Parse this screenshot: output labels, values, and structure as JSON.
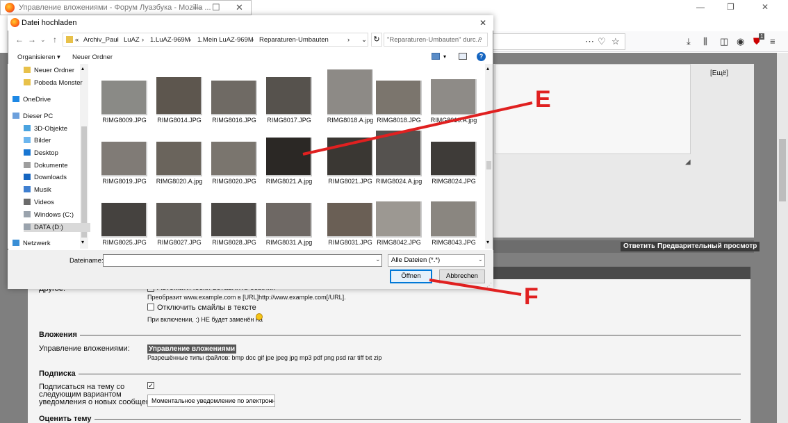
{
  "background_window": {
    "title": "Управление вложениями - Форум Луазбука - Mozilla ...",
    "controls": {
      "minimize": "—",
      "maximize": "☐",
      "close": "✕"
    }
  },
  "browser": {
    "toolbar_badge": "1"
  },
  "forum": {
    "more_link": "[Ещё]",
    "reply_button": "Ответить",
    "preview_button": "Предварительный просмотр",
    "other_label": "Другое:",
    "auto_links_option": "Автоматически вставлять ссылки",
    "auto_links_hint": "Преобразит www.example.com в [URL]http://www.example.com[/URL].",
    "disable_smilies_option": "Отключить смайлы в тексте",
    "smilies_hint": "При включении, :) НЕ будет заменён на",
    "attachments_section": "Вложения",
    "manage_attachments_label": "Управление вложениями:",
    "manage_attachments_button": "Управление вложениями",
    "allowed_types": "Разрешённые типы файлов: bmp doc gif jpe jpeg jpg mp3 pdf png psd rar tiff txt zip",
    "subscription_section": "Подписка",
    "subscribe_label_lines": [
      "Подписаться на тему со",
      "следующим вариантом",
      "уведомления о новых сообщениях:"
    ],
    "subscribe_value": "Моментальное уведомление по электронн",
    "rate_section": "Оценить тему"
  },
  "dialog": {
    "title": "Datei hochladen",
    "breadcrumb": [
      "«",
      "Archiv_Paul",
      "LuAZ",
      "1.LuAZ-969M",
      "1.Mein LuAZ-969M",
      "Reparaturen-Umbauten"
    ],
    "search_placeholder": "\"Reparaturen-Umbauten\" durc...",
    "organize": "Organisieren ▾",
    "new_folder": "Neuer Ordner",
    "help": "?",
    "nav_items": [
      {
        "label": "Neuer Ordner",
        "icon": "folder-icon"
      },
      {
        "label": "Pobeda Monster",
        "icon": "folder-icon"
      },
      {
        "label": "OneDrive",
        "icon": "cloud-icon"
      },
      {
        "label": "Dieser PC",
        "icon": "computer-icon"
      },
      {
        "label": "3D-Objekte",
        "icon": "cube-icon"
      },
      {
        "label": "Bilder",
        "icon": "pictures-icon"
      },
      {
        "label": "Desktop",
        "icon": "desktop-icon"
      },
      {
        "label": "Dokumente",
        "icon": "documents-icon"
      },
      {
        "label": "Downloads",
        "icon": "download-icon"
      },
      {
        "label": "Musik",
        "icon": "music-icon"
      },
      {
        "label": "Videos",
        "icon": "videos-icon"
      },
      {
        "label": "Windows (C:)",
        "icon": "drive-icon"
      },
      {
        "label": "DATA (D:)",
        "icon": "drive-icon"
      },
      {
        "label": "Netzwerk",
        "icon": "network-icon"
      }
    ],
    "files": [
      "RIMG8009.JPG",
      "RIMG8014.JPG",
      "RIMG8016.JPG",
      "RIMG8017.JPG",
      "RIMG8018.A.jpg",
      "RIMG8018.JPG",
      "RIMG8019.A.jpg",
      "RIMG8019.JPG",
      "RIMG8020.A.jpg",
      "RIMG8020.JPG",
      "RIMG8021.A.jpg",
      "RIMG8021.JPG",
      "RIMG8024.A.jpg",
      "RIMG8024.JPG",
      "RIMG8025.JPG",
      "RIMG8027.JPG",
      "RIMG8028.JPG",
      "RIMG8031.A.jpg",
      "RIMG8031.JPG",
      "RIMG8042.JPG",
      "RIMG8043.JPG"
    ],
    "thumb_colors": [
      "#8a8a86",
      "#5d564e",
      "#6f6a64",
      "#56524d",
      "#8d8a86",
      "#7b756d",
      "#8e8b87",
      "#807b76",
      "#6a645c",
      "#7a756e",
      "#2b2825",
      "#3a3733",
      "#55524f",
      "#3e3b38",
      "#45423f",
      "#5e5a55",
      "#4b4845",
      "#6e6864",
      "#6a5f55",
      "#9c9892",
      "#8a8680"
    ],
    "filename_label": "Dateiname:",
    "filename_value": "",
    "filter": "Alle Dateien (*.*)",
    "open_button": "Öffnen",
    "cancel_button": "Abbrechen"
  },
  "annotations": {
    "E": "E",
    "F": "F",
    "color": "#e02020"
  }
}
